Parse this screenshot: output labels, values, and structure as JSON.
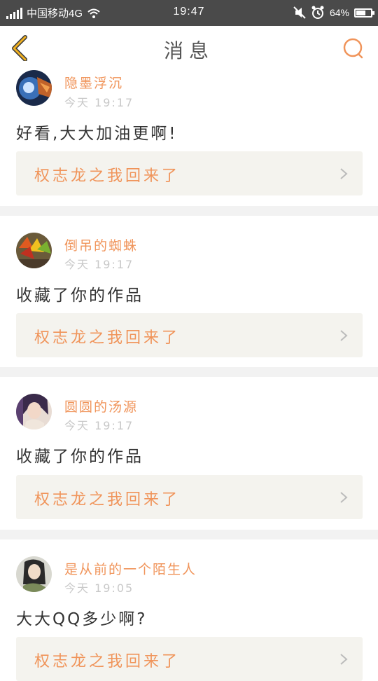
{
  "status_bar": {
    "carrier": "中国移动4G",
    "time": "19:47",
    "battery": "64%",
    "battery_level": 0.64
  },
  "header": {
    "title": "消息",
    "back_icon": "chevron-left-icon",
    "search_icon": "search-icon",
    "accent_color": "#f0a830"
  },
  "messages": [
    {
      "username": "隐墨浮沉",
      "time": "今天 19:17",
      "text": "好看,大大加油更啊!",
      "work_title": "权志龙之我回来了"
    },
    {
      "username": "倒吊的蜘蛛",
      "time": "今天 19:17",
      "text": "收藏了你的作品",
      "work_title": "权志龙之我回来了"
    },
    {
      "username": "圆圆的汤源",
      "time": "今天 19:17",
      "text": "收藏了你的作品",
      "work_title": "权志龙之我回来了"
    },
    {
      "username": "是从前的一个陌生人",
      "time": "今天 19:05",
      "text": "大大QQ多少啊?",
      "work_title": "权志龙之我回来了"
    }
  ],
  "colors": {
    "username": "#f0945a",
    "work_title": "#f0945a",
    "work_bg": "#f4f3ee",
    "divider": "#f2f2f2"
  }
}
